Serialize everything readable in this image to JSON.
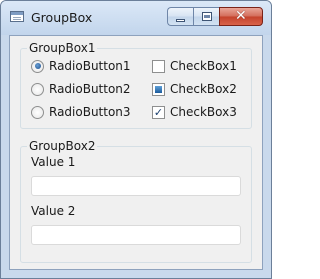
{
  "window": {
    "title": "GroupBox",
    "close_glyph": "✕"
  },
  "groupbox1": {
    "title": "GroupBox1",
    "radios": [
      {
        "label": "RadioButton1",
        "checked": true
      },
      {
        "label": "RadioButton2",
        "checked": false
      },
      {
        "label": "RadioButton3",
        "checked": false
      }
    ],
    "checkboxes": [
      {
        "label": "CheckBox1",
        "state": "unchecked"
      },
      {
        "label": "CheckBox2",
        "state": "indeterminate"
      },
      {
        "label": "CheckBox3",
        "state": "checked",
        "glyph": "✓"
      }
    ]
  },
  "groupbox2": {
    "title": "GroupBox2",
    "fields": [
      {
        "label": "Value 1",
        "value": ""
      },
      {
        "label": "Value 2",
        "value": ""
      }
    ]
  }
}
